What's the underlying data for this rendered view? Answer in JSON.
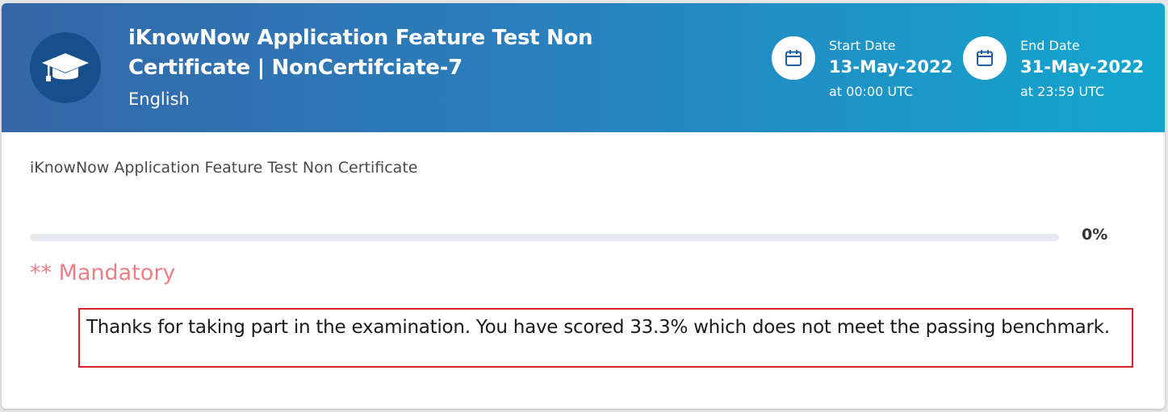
{
  "header": {
    "title": "iKnowNow Application Feature Test Non Certificate | NonCertifciate-7",
    "language": "English",
    "icon": "graduation-cap-icon",
    "gradient": [
      "#3467a8",
      "#12a6cf"
    ],
    "start": {
      "label": "Start Date",
      "date": "13-May-2022",
      "time": "at 00:00 UTC",
      "icon": "calendar-icon"
    },
    "end": {
      "label": "End Date",
      "date": "31-May-2022",
      "time": "at 23:59 UTC",
      "icon": "calendar-icon"
    }
  },
  "body": {
    "subtitle": "iKnowNow Application Feature Test Non Certificate",
    "progress": {
      "label": "0%",
      "fraction": 0
    },
    "mandatory_text": "** Mandatory",
    "mandatory_color": "#f07e85",
    "message": "Thanks for taking part in the examination. You have scored 33.3% which does not meet the passing benchmark.",
    "message_border_color": "#d6202b"
  }
}
